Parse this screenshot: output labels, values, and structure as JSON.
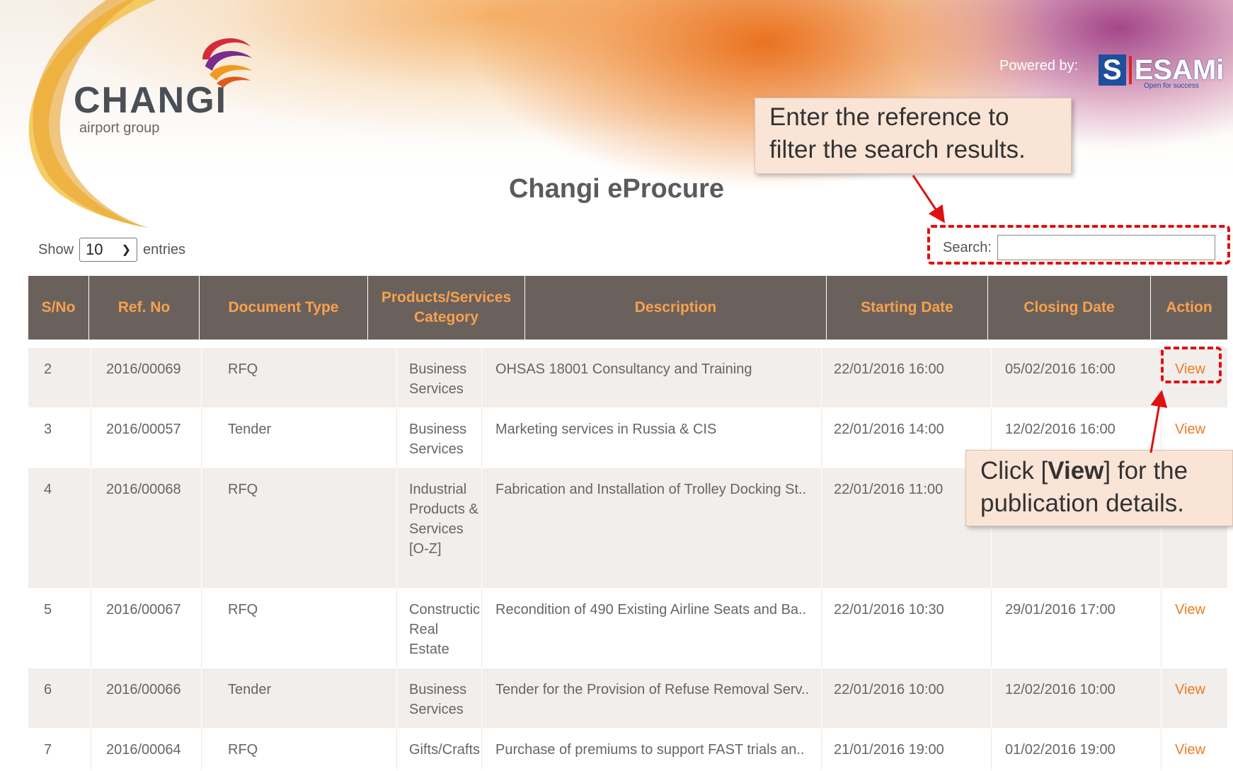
{
  "header": {
    "logo_name": "CHANGI",
    "logo_sub": "airport group",
    "powered_by": "Powered by:",
    "sesami_s": "S",
    "sesami_rest": "ESAMi",
    "sesami_tagline": "Open for success",
    "page_title": "Changi eProcure"
  },
  "controls": {
    "show_label": "Show",
    "entries_value": "10",
    "entries_label": "entries",
    "search_label": "Search:",
    "search_value": ""
  },
  "table": {
    "headers": {
      "sno": "S/No",
      "ref": "Ref. No",
      "doctype": "Document Type",
      "category": "Products/Services Category",
      "description": "Description",
      "start": "Starting Date",
      "close": "Closing Date",
      "action": "Action"
    },
    "rows": [
      {
        "sno": "2",
        "ref": "2016/00069",
        "doctype": "RFQ",
        "category": "Business Services",
        "description": "OHSAS 18001 Consultancy and Training",
        "start": "22/01/2016 16:00",
        "close": "05/02/2016 16:00",
        "action": "View"
      },
      {
        "sno": "3",
        "ref": "2016/00057",
        "doctype": "Tender",
        "category": "Business Services",
        "description": "Marketing services in Russia & CIS",
        "start": "22/01/2016 14:00",
        "close": "12/02/2016 16:00",
        "action": "View"
      },
      {
        "sno": "4",
        "ref": "2016/00068",
        "doctype": "RFQ",
        "category": "Industrial Products & Services [O-Z]",
        "description": "Fabrication and Installation of Trolley Docking St..",
        "start": "22/01/2016 11:00",
        "close": "",
        "action": ""
      },
      {
        "sno": "5",
        "ref": "2016/00067",
        "doctype": "RFQ",
        "category": "Constructic Real Estate",
        "description": "Recondition of 490 Existing Airline Seats and Ba..",
        "start": "22/01/2016 10:30",
        "close": "29/01/2016 17:00",
        "action": "View"
      },
      {
        "sno": "6",
        "ref": "2016/00066",
        "doctype": "Tender",
        "category": "Business Services",
        "description": "Tender for the Provision of Refuse Removal Serv..",
        "start": "22/01/2016 10:00",
        "close": "12/02/2016 10:00",
        "action": "View"
      },
      {
        "sno": "7",
        "ref": "2016/00064",
        "doctype": "RFQ",
        "category": "Gifts/Crafts",
        "description": "Purchase of premiums to support FAST trials an..",
        "start": "21/01/2016 19:00",
        "close": "01/02/2016 19:00",
        "action": "View"
      }
    ]
  },
  "callouts": {
    "search_text": "Enter the reference to filter the search results.",
    "view_text_pre": "Click [",
    "view_text_bold": "View",
    "view_text_post": "] for the publication details."
  },
  "colors": {
    "header_bg": "#6b615c",
    "header_text": "#f7a14e",
    "link": "#f07a2a",
    "annotation": "#e01010",
    "callout_bg": "#fae4d6"
  }
}
